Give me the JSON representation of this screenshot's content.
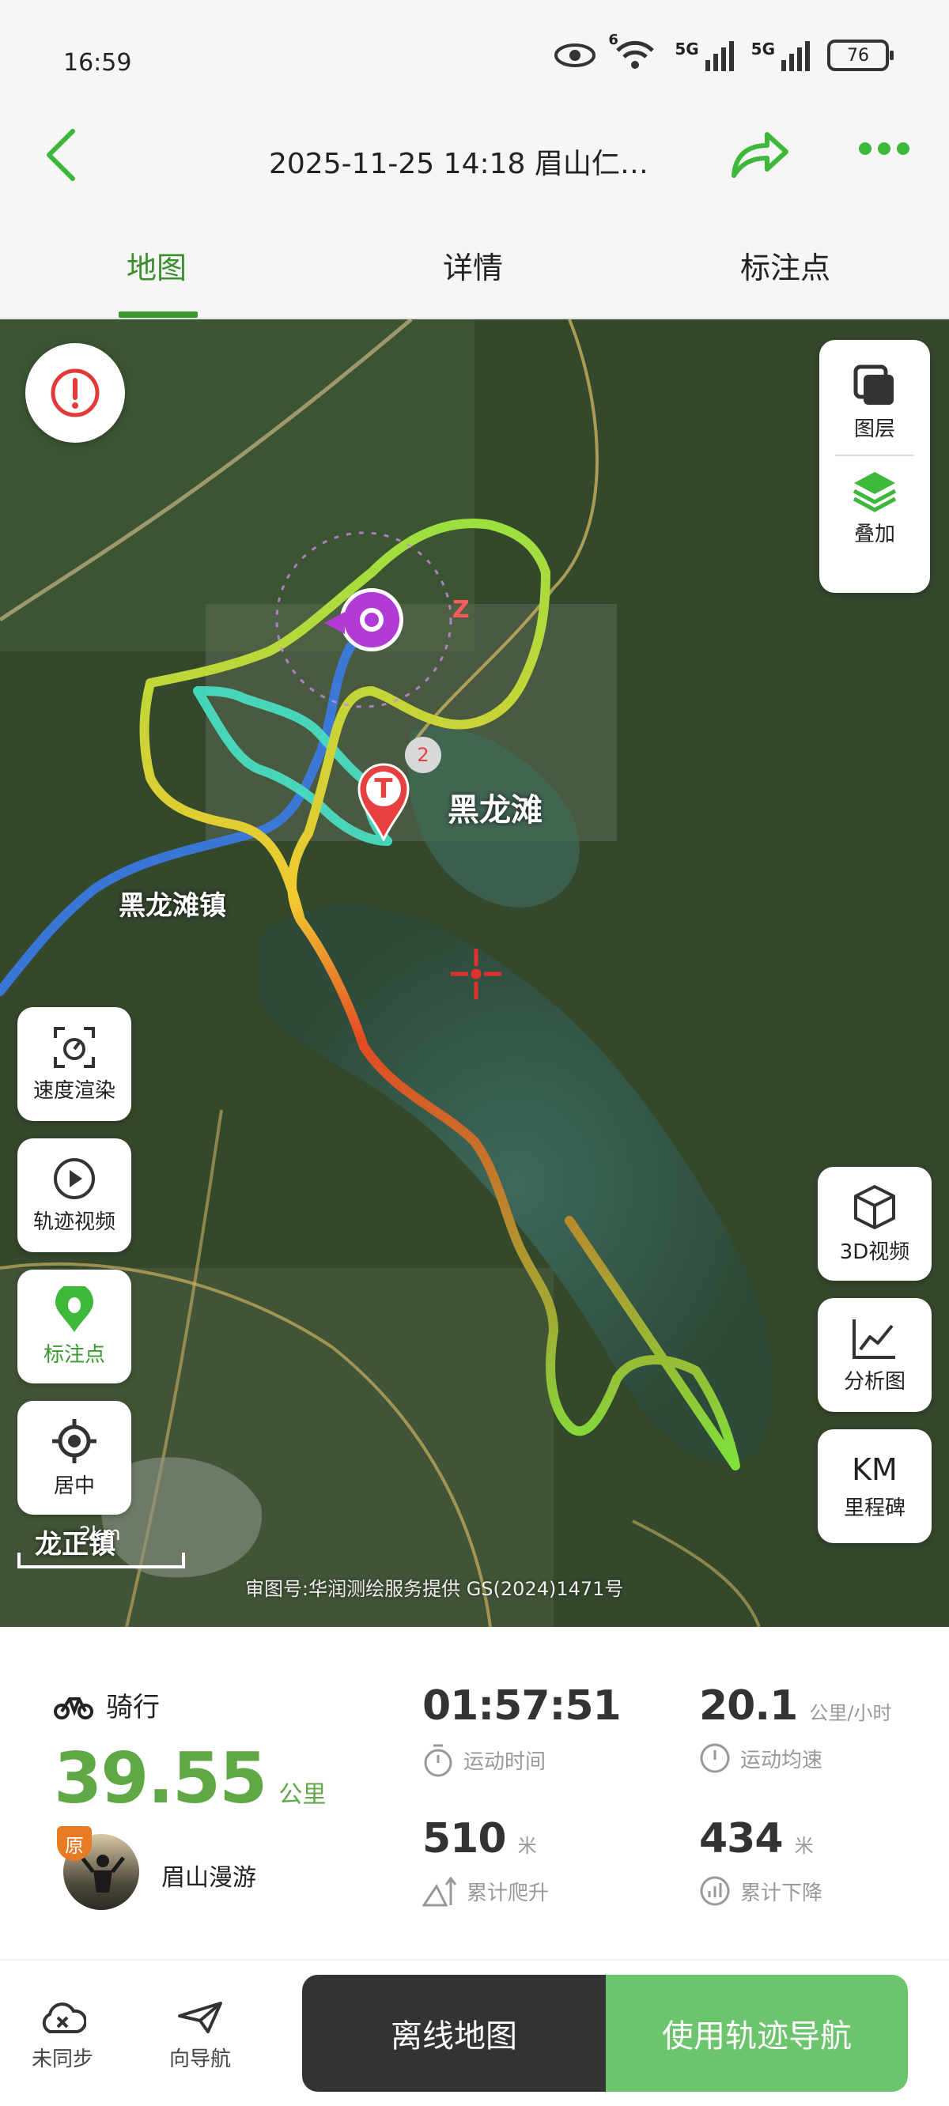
{
  "status_bar": {
    "time": "16:59",
    "net1": "5G",
    "net2": "5G",
    "wifi_badge": "6",
    "battery": "76"
  },
  "header": {
    "title": "2025-11-25 14:18 眉山仁…",
    "back_icon": "chevron-left-icon",
    "share_icon": "share-arrow-icon",
    "more_icon": "more-dots-icon"
  },
  "tabs": [
    {
      "label": "地图",
      "active": true
    },
    {
      "label": "详情",
      "active": false
    },
    {
      "label": "标注点",
      "active": false
    }
  ],
  "map": {
    "place_labels": {
      "town1": "黑龙滩镇",
      "town2": "龙正镇",
      "lake": "黑龙滩"
    },
    "scale": "2km",
    "copyright": "审图号:华润测绘服务提供 GS(2024)1471号",
    "start_marker_label": "T",
    "overlap_badge": "2",
    "end_marker": "Z",
    "accent_color": "#3db83a",
    "right_buttons": [
      {
        "label": "图层",
        "icon": "map-layer-icon"
      },
      {
        "label": "叠加",
        "icon": "layers-stack-icon"
      }
    ],
    "left_buttons": [
      {
        "label": "速度渲染",
        "icon": "speed-render-icon",
        "highlight": false
      },
      {
        "label": "轨迹视频",
        "icon": "play-icon",
        "highlight": false
      },
      {
        "label": "标注点",
        "icon": "footprint-pin-icon",
        "highlight": true
      },
      {
        "label": "居中",
        "icon": "locate-center-icon",
        "highlight": false
      }
    ],
    "right_bottom_buttons": [
      {
        "label": "3D视频",
        "icon": "cube-3d-icon"
      },
      {
        "label": "分析图",
        "icon": "line-chart-icon"
      },
      {
        "label": "里程碑",
        "icon_text": "KM"
      }
    ]
  },
  "stats": {
    "sport": "骑行",
    "distance": "39.55",
    "distance_unit": "公里",
    "username": "眉山漫游",
    "original_badge": "原",
    "items": [
      {
        "value": "01:57:51",
        "unit": "",
        "label": "运动时间"
      },
      {
        "value": "20.1",
        "unit": "公里/小时",
        "label": "运动均速"
      },
      {
        "value": "510",
        "unit": "米",
        "label": "累计爬升"
      },
      {
        "value": "434",
        "unit": "米",
        "label": "累计下降"
      }
    ]
  },
  "bottom_bar": {
    "cloud_label": "未同步",
    "send_label": "向导航",
    "offline_label": "离线地图",
    "navigate_label": "使用轨迹导航"
  }
}
